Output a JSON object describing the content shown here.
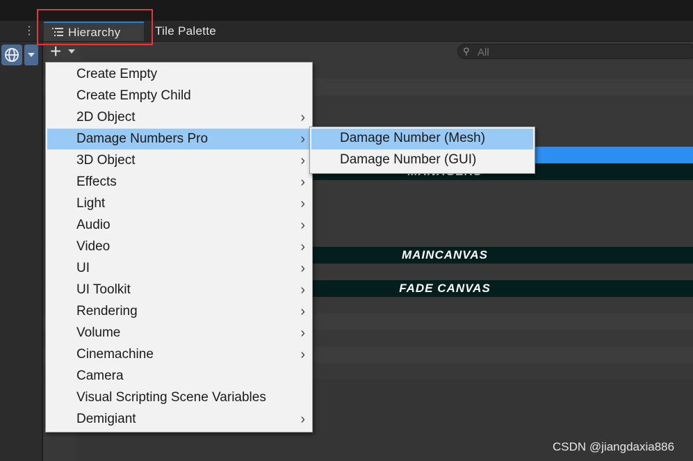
{
  "tabs": {
    "hierarchy_label": "Hierarchy",
    "tile_palette_label": "Tile Palette"
  },
  "search": {
    "placeholder": "All"
  },
  "menu": {
    "items": [
      {
        "label": "Create Empty",
        "submenu": false
      },
      {
        "label": "Create Empty Child",
        "submenu": false
      },
      {
        "label": "2D Object",
        "submenu": true
      },
      {
        "label": "Damage Numbers Pro",
        "submenu": true,
        "selected": true
      },
      {
        "label": "3D Object",
        "submenu": true
      },
      {
        "label": "Effects",
        "submenu": true
      },
      {
        "label": "Light",
        "submenu": true
      },
      {
        "label": "Audio",
        "submenu": true
      },
      {
        "label": "Video",
        "submenu": true
      },
      {
        "label": "UI",
        "submenu": true
      },
      {
        "label": "UI Toolkit",
        "submenu": true
      },
      {
        "label": "Rendering",
        "submenu": true
      },
      {
        "label": "Volume",
        "submenu": true
      },
      {
        "label": "Cinemachine",
        "submenu": true
      },
      {
        "label": "Camera",
        "submenu": false
      },
      {
        "label": "Visual Scripting Scene Variables",
        "submenu": false
      },
      {
        "label": "Demigiant",
        "submenu": true
      }
    ],
    "chevron": "›"
  },
  "submenu": {
    "items": [
      {
        "label": "Damage Number (Mesh)",
        "selected": true
      },
      {
        "label": "Damage Number (GUI)",
        "selected": false
      }
    ]
  },
  "hierarchy": {
    "bands": [
      "MANAGERS",
      "MAINCANVAS",
      "FADE CANVAS"
    ]
  },
  "watermark": "CSDN @jiangdaxia886",
  "colors": {
    "selection": "#99c9f5",
    "blue_row": "#2c8ef0",
    "red_box": "#e53935"
  }
}
